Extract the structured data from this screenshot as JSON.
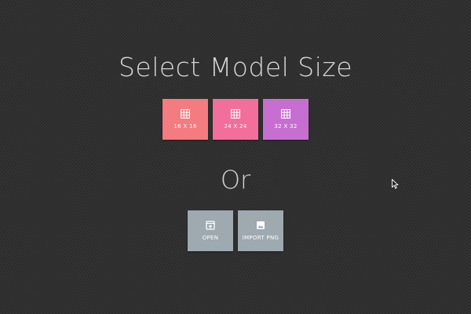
{
  "title": "Select Model Size",
  "sizes": [
    {
      "label": "16 X 16",
      "icon": "grid-icon",
      "color": "#f47b7f"
    },
    {
      "label": "24 X 24",
      "icon": "grid-icon",
      "color": "#f26f9b"
    },
    {
      "label": "32  X 32",
      "icon": "grid-icon",
      "color": "#c66fd1"
    }
  ],
  "separator": "Or",
  "actions": [
    {
      "label": "OPEN",
      "icon": "open-icon",
      "color": "#9ea9b0"
    },
    {
      "label": "IMPORT PNG",
      "icon": "image-icon",
      "color": "#9ea9b0"
    }
  ]
}
